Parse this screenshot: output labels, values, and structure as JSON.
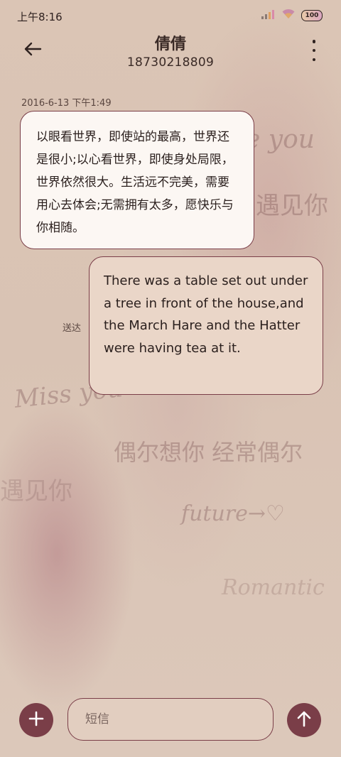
{
  "status_bar": {
    "time": "上午8:16",
    "battery": "100"
  },
  "header": {
    "contact_name": "倩倩",
    "contact_number": "18730218809"
  },
  "conversation": {
    "timestamp": "2016-6-13 下午1:49",
    "messages": [
      {
        "direction": "incoming",
        "text": "以眼看世界，即使站的最高，世界还是很小;以心看世界，即使身处局限，世界依然很大。生活远不完美，需要用心去体会;无需拥有太多，愿快乐与你相随。"
      },
      {
        "direction": "outgoing",
        "text": "There was a table set out under a tree in front of the house,and the March Hare and the Hatter were having tea at it.",
        "status": "送达"
      }
    ]
  },
  "background_text": [
    "e you",
    "遇见你",
    "Miss you",
    "偶尔想你 经常偶尔",
    "遇见你",
    "future→♡",
    "Romantic"
  ],
  "composer": {
    "placeholder": "短信"
  },
  "colors": {
    "accent": "#7a3e48",
    "background": "#dcc6b6",
    "incoming_bubble": "#fcf7f3",
    "outgoing_bubble": "#ead6c8"
  }
}
